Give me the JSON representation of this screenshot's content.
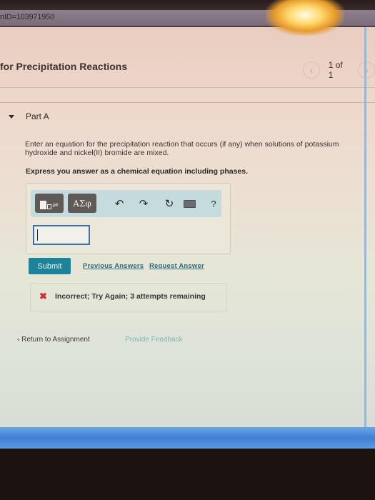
{
  "browser": {
    "url_fragment": "nID=103971950"
  },
  "header": {
    "title": "for Precipitation Reactions",
    "pager": {
      "prev_icon": "chevron-left-icon",
      "text": "1 of 1",
      "next_icon": "chevron-right-icon"
    }
  },
  "part": {
    "toggle_icon": "caret-down-icon",
    "label": "Part A",
    "question": "Enter an equation for the precipitation reaction that occurs (if any) when solutions of potassium hydroxide and nickel(II) bromide are mixed.",
    "instruction": "Express you answer as a chemical equation including phases."
  },
  "editor": {
    "templates_icon": "templates-icon",
    "symbols_label": "ΑΣφ",
    "undo_icon": "undo-icon",
    "redo_icon": "redo-icon",
    "reset_icon": "reset-icon",
    "keyboard_icon": "keyboard-icon",
    "help_label": "?",
    "input_value": ""
  },
  "actions": {
    "submit_label": "Submit",
    "previous_answers_label": "Previous Answers",
    "request_answer_label": "Request Answer"
  },
  "feedback": {
    "status_icon": "x-icon",
    "text": "Incorrect; Try Again; 3 attempts remaining",
    "status_color": "#d0302d"
  },
  "footer": {
    "return_label": "Return to Assignment",
    "return_icon": "chevron-left-icon",
    "provide_feedback_label": "Provide Feedback"
  },
  "colors": {
    "submit_bg": "#1d8398",
    "link": "#2d6b82",
    "toolbar_bg": "#c6dbdd",
    "input_border": "#3f6fa8"
  }
}
